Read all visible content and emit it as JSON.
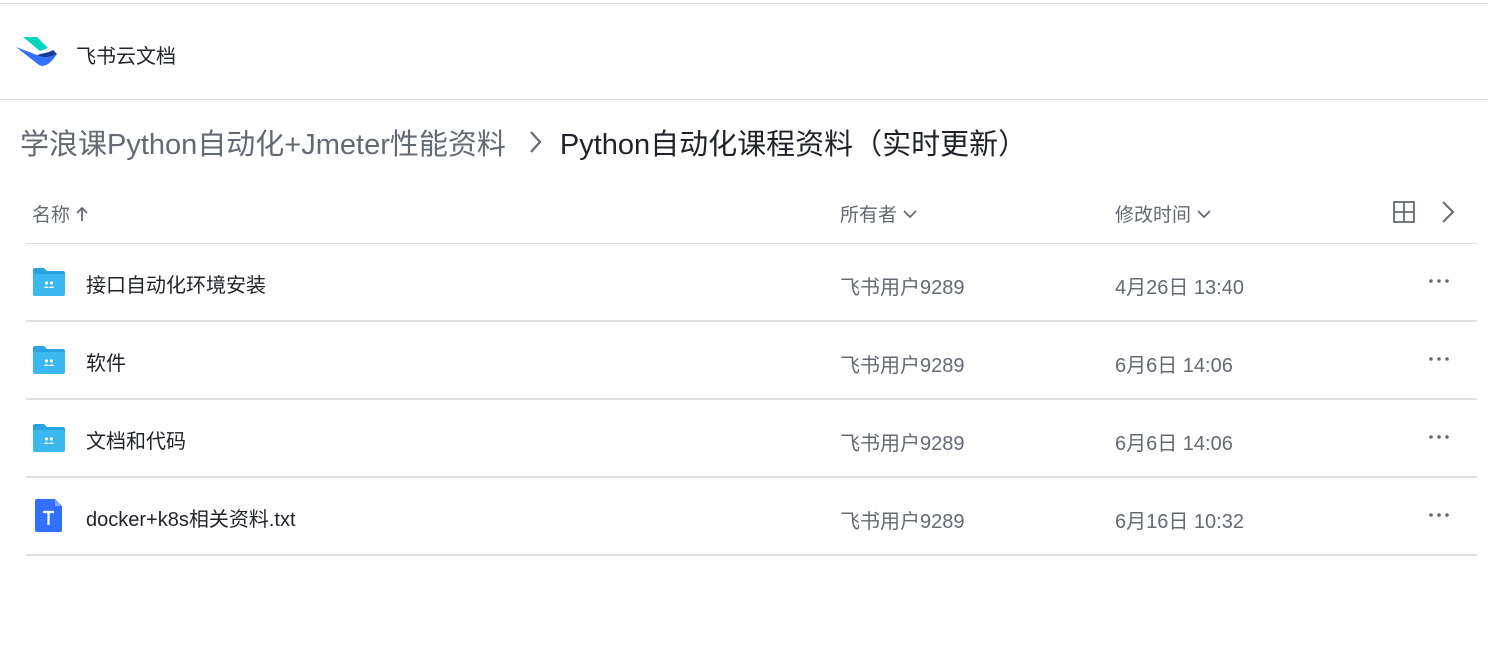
{
  "header": {
    "app_title": "飞书云文档"
  },
  "breadcrumb": {
    "parent": "学浪课Python自动化+Jmeter性能资料",
    "current": "Python自动化课程资料（实时更新）"
  },
  "table": {
    "columns": {
      "name": "名称",
      "owner": "所有者",
      "modified": "修改时间"
    },
    "rows": [
      {
        "type": "folder",
        "name": "接口自动化环境安装",
        "owner": "飞书用户9289",
        "modified": "4月26日 13:40"
      },
      {
        "type": "folder",
        "name": "软件",
        "owner": "飞书用户9289",
        "modified": "6月6日 14:06"
      },
      {
        "type": "folder",
        "name": "文档和代码",
        "owner": "飞书用户9289",
        "modified": "6月6日 14:06"
      },
      {
        "type": "txt",
        "name": "docker+k8s相关资料.txt",
        "owner": "飞书用户9289",
        "modified": "6月16日 10:32"
      }
    ]
  },
  "colors": {
    "folder": "#3cb8f0",
    "folder_tab": "#2aa3e0",
    "txt_file": "#3370ff",
    "border": "#dee0e3",
    "text_primary": "#1f2329",
    "text_secondary": "#646a73"
  },
  "icons": {
    "logo": "feishu-logo",
    "sort": "arrow-up-icon",
    "dropdown": "chevron-down-icon",
    "grid_view": "grid-icon",
    "next": "chevron-right-icon",
    "more": "more-icon",
    "folder": "shared-folder-icon",
    "txt": "txt-file-icon"
  }
}
